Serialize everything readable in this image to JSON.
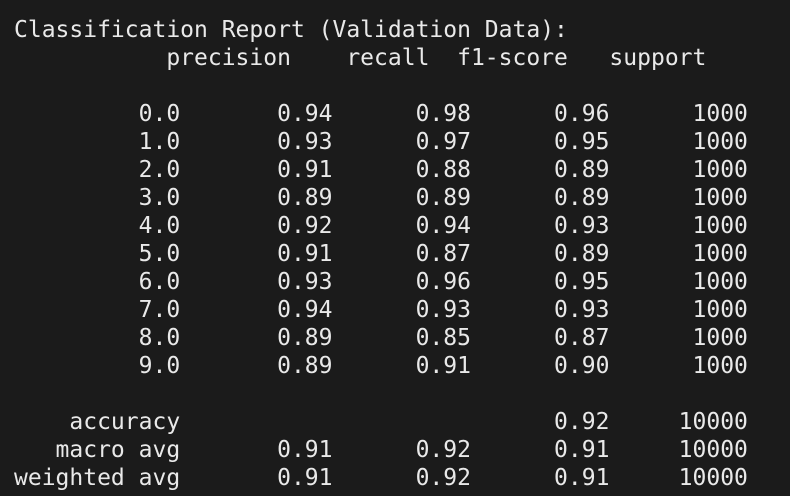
{
  "report": {
    "title": "Classification Report (Validation Data):",
    "header": "           precision    recall  f1-score   support",
    "rows": [
      "         0.0       0.94      0.98      0.96      1000",
      "         1.0       0.93      0.97      0.95      1000",
      "         2.0       0.91      0.88      0.89      1000",
      "         3.0       0.89      0.89      0.89      1000",
      "         4.0       0.92      0.94      0.93      1000",
      "         5.0       0.91      0.87      0.89      1000",
      "         6.0       0.93      0.96      0.95      1000",
      "         7.0       0.94      0.93      0.93      1000",
      "         8.0       0.89      0.85      0.87      1000",
      "         9.0       0.89      0.91      0.90      1000"
    ],
    "summary": [
      "    accuracy                           0.92     10000",
      "   macro avg       0.91      0.92      0.91     10000",
      "weighted avg       0.91      0.92      0.91     10000"
    ]
  }
}
